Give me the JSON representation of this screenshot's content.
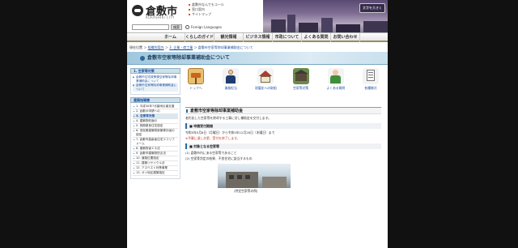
{
  "header": {
    "logo_text": "倉敷市",
    "logo_sub": "KURASHIKI CITY",
    "top_links": [
      "倉敷市なんでもコール",
      "窓口案内",
      "サイトマップ"
    ],
    "font_size_button": "文字を大きく",
    "search_button": "検索",
    "language_link": "Foreign Languages"
  },
  "nav": [
    "ホーム",
    "くらしのガイド",
    "観光情報",
    "ビジネス情報",
    "市政について",
    "よくある質問",
    "お問い合わせ"
  ],
  "breadcrumb": {
    "items": [
      "現在位置",
      "＞",
      "組織別案内",
      "＞",
      "3. 企業・商工業",
      "＞",
      "倉敷市空家等除却事業補助金について"
    ]
  },
  "page_title": "倉敷市空家等除却事業補助金について",
  "sidebar": {
    "section1_title": "1. 空家等対策",
    "section1_items": [
      "倉敷市住宅政策課空家等除却事業補助金について",
      "倉敷市空家等除却事業補助金について"
    ],
    "section2_title": "建築指導課",
    "section2_items": [
      "1. 平成30年7月豪雨災害支援",
      "2. 倉敷の申請への",
      "3. 空家等対策",
      "4. 建築物前面の",
      "5. 長期優良住宅認定",
      "6. 低炭素建築物新築等計画の認定",
      "7. 倉敷市高齢者住宅エコリフォーム",
      "8. 建築物省エネ法",
      "9. 倉敷市建築物防災法",
      "10. 道路位置指定",
      "11. 建築リサイクル法",
      "12. アスベスト対策事業",
      "13. ガイ地区建築指定"
    ]
  },
  "icon_menu": [
    {
      "label": "トップへ",
      "icon": "top-sign-icon"
    },
    {
      "label": "業務担当",
      "icon": "staff-icon"
    },
    {
      "label": "耐震化への取組",
      "icon": "house-icon"
    },
    {
      "label": "空家等対策",
      "icon": "vacant-house-icon"
    },
    {
      "label": "よくある質問",
      "icon": "faq-icon"
    },
    {
      "label": "各種様式",
      "icon": "forms-icon"
    }
  ],
  "main": {
    "section_title": "倉敷市空家等除却事業補助金",
    "intro": "老朽化した空家等を除却する工事に対し補助金を交付します。",
    "subhead1": "■ 申請受付期間",
    "period": "令和5年5月8日（月曜日）から令和5年12月28日（木曜日）まで",
    "period_note": "※予算に達し次第、受付を終了します。",
    "subhead2": "■ 対象となる空家等",
    "criteria1": "(1) 倉敷市内にある空家等であること",
    "criteria2": "(2) 空家等判定の結果、不良住宅に該当するもの",
    "photo_caption": "(特定空家等の例)"
  }
}
